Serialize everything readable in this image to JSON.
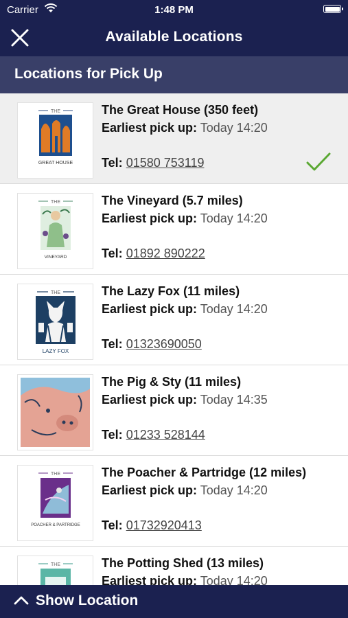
{
  "status_bar": {
    "carrier": "Carrier",
    "time": "1:48 PM"
  },
  "nav": {
    "title": "Available Locations",
    "close_icon": "close-icon"
  },
  "section": {
    "title": "Locations for Pick Up"
  },
  "colors": {
    "nav": "#1b2150",
    "section": "#393f68",
    "check": "#5aa832",
    "selected_row": "#efefef"
  },
  "labels": {
    "earliest": "Earliest pick up:",
    "tel": "Tel:"
  },
  "locations": [
    {
      "name": "The Great House (350 feet)",
      "pickup": "Today 14:20",
      "tel": "01580 753119",
      "selected": true,
      "logo": {
        "top": "THE",
        "bottom": "GREAT HOUSE"
      }
    },
    {
      "name": "The Vineyard (5.7 miles)",
      "pickup": "Today 14:20",
      "tel": "01892 890222",
      "selected": false,
      "logo": {
        "top": "THE",
        "bottom": "VINEYARD"
      }
    },
    {
      "name": "The Lazy Fox (11 miles)",
      "pickup": "Today 14:20",
      "tel": "01323690050",
      "selected": false,
      "logo": {
        "top": "THE",
        "bottom": "LAZY FOX"
      }
    },
    {
      "name": "The Pig & Sty (11 miles)",
      "pickup": "Today 14:35",
      "tel": "01233 528144",
      "selected": false
    },
    {
      "name": "The Poacher & Partridge (12 miles)",
      "pickup": "Today 14:20",
      "tel": "01732920413",
      "selected": false,
      "logo": {
        "top": "THE",
        "bottom": "POACHER & PARTRIDGE"
      }
    },
    {
      "name": "The Potting Shed (13 miles)",
      "pickup": "Today 14:20",
      "tel": "",
      "selected": false,
      "logo": {
        "top": "THE"
      }
    }
  ],
  "bottom_bar": {
    "label": "Show Location",
    "icon": "chevron-up-icon"
  }
}
